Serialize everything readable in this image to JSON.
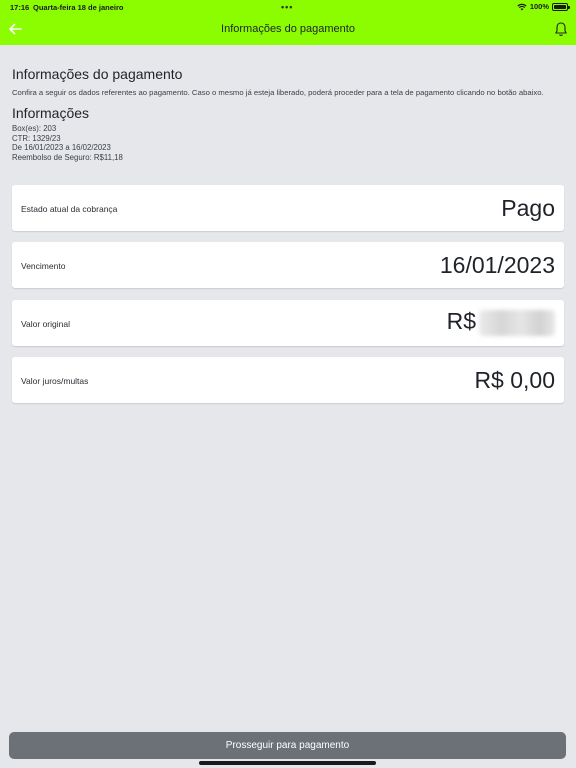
{
  "status_bar": {
    "time": "17:16",
    "date": "Quarta-feira 18 de janeiro",
    "dots": "•••",
    "battery": "100%"
  },
  "header": {
    "title": "Informações do pagamento",
    "back_icon": "arrow-left-icon",
    "notification_icon": "bell-icon"
  },
  "page": {
    "heading": "Informações do pagamento",
    "description": "Confira a seguir os dados referentes ao pagamento. Caso o mesmo já esteja liberado, poderá proceder para a tela de pagamento clicando no botão abaixo.",
    "info_heading": "Informações",
    "info_lines": [
      "Box(es): 203",
      "CTR: 1329/23",
      "De 16/01/2023 a 16/02/2023",
      "Reembolso de Seguro: R$11,18"
    ]
  },
  "cards": [
    {
      "label": "Estado atual da cobrança",
      "value": "Pago"
    },
    {
      "label": "Vencimento",
      "value": "16/01/2023"
    },
    {
      "label": "Valor original",
      "value": "R$"
    },
    {
      "label": "Valor juros/multas",
      "value": "R$ 0,00"
    }
  ],
  "footer": {
    "button_label": "Prosseguir para pagamento"
  },
  "colors": {
    "header_bg": "#8cfc00",
    "page_bg": "#e5e7eb",
    "button_bg": "#6b7177"
  }
}
